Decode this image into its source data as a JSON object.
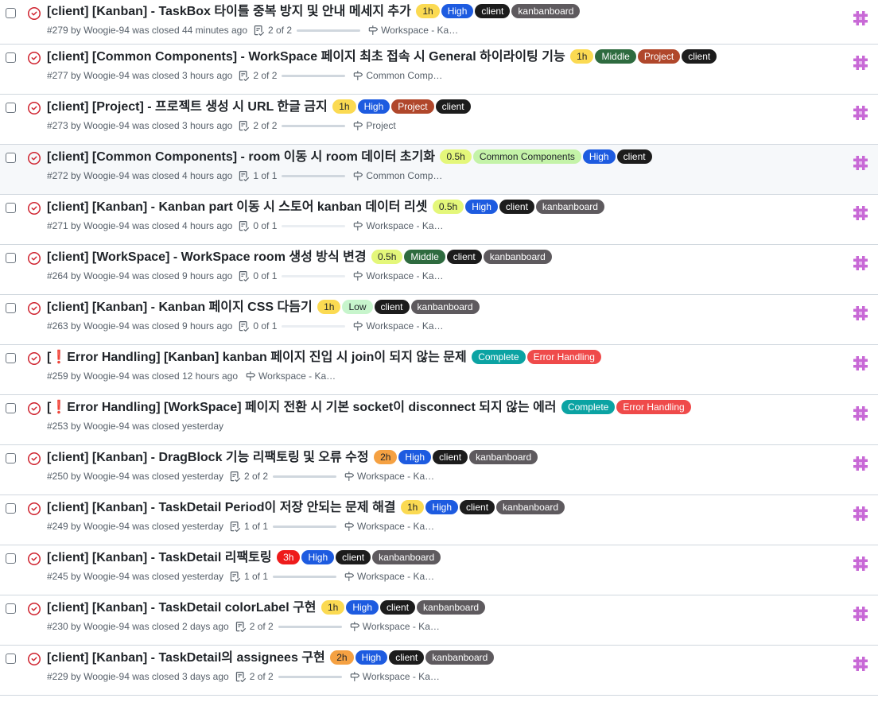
{
  "colors": {
    "closed_icon": "#cf222e",
    "accent": "#0969da",
    "avatar": "#c869d6"
  },
  "issues": [
    {
      "title": "[client] [Kanban] - TaskBox 타이틀 중복 방지 및 안내 메세지 추가",
      "number": "#279",
      "author": "Woogie-94",
      "closed": "44 minutes ago",
      "tasks": "2 of 2",
      "progress": 1.0,
      "milestone": "Workspace - Ka…",
      "labels": [
        {
          "text": "1h",
          "bg": "#fbda52",
          "fg": "#1f2328"
        },
        {
          "text": "High",
          "bg": "#1d5be0",
          "fg": "#ffffff"
        },
        {
          "text": "client",
          "bg": "#1c1c1c",
          "fg": "#ffffff"
        },
        {
          "text": "kanbanboard",
          "bg": "#5e5a5e",
          "fg": "#ffffff"
        }
      ]
    },
    {
      "title": "[client] [Common Components] - WorkSpace 페이지 최초 접속 시 General 하이라이팅 기능",
      "number": "#277",
      "author": "Woogie-94",
      "closed": "3 hours ago",
      "tasks": "2 of 2",
      "progress": 1.0,
      "milestone": "Common Comp…",
      "labels": [
        {
          "text": "1h",
          "bg": "#fbda52",
          "fg": "#1f2328"
        },
        {
          "text": "Middle",
          "bg": "#2e6b3f",
          "fg": "#ffffff"
        },
        {
          "text": "Project",
          "bg": "#b0472b",
          "fg": "#ffffff"
        },
        {
          "text": "client",
          "bg": "#1c1c1c",
          "fg": "#ffffff"
        }
      ]
    },
    {
      "title": "[client] [Project] - 프로젝트 생성 시 URL 한글 금지",
      "number": "#273",
      "author": "Woogie-94",
      "closed": "3 hours ago",
      "tasks": "2 of 2",
      "progress": 1.0,
      "milestone": "Project",
      "labels": [
        {
          "text": "1h",
          "bg": "#fbda52",
          "fg": "#1f2328"
        },
        {
          "text": "High",
          "bg": "#1d5be0",
          "fg": "#ffffff"
        },
        {
          "text": "Project",
          "bg": "#b0472b",
          "fg": "#ffffff"
        },
        {
          "text": "client",
          "bg": "#1c1c1c",
          "fg": "#ffffff"
        }
      ]
    },
    {
      "title": "[client] [Common Components] - room 이동 시 room 데이터 초기화",
      "number": "#272",
      "author": "Woogie-94",
      "closed": "4 hours ago",
      "tasks": "1 of 1",
      "progress": 1.0,
      "milestone": "Common Comp…",
      "labels": [
        {
          "text": "0.5h",
          "bg": "#e4f77a",
          "fg": "#1f2328"
        },
        {
          "text": "Common Components",
          "bg": "#c4f3a8",
          "fg": "#1f2328"
        },
        {
          "text": "High",
          "bg": "#1d5be0",
          "fg": "#ffffff"
        },
        {
          "text": "client",
          "bg": "#1c1c1c",
          "fg": "#ffffff"
        }
      ]
    },
    {
      "title": "[client] [Kanban] - Kanban part 이동 시 스토어 kanban 데이터 리셋",
      "number": "#271",
      "author": "Woogie-94",
      "closed": "4 hours ago",
      "tasks": "0 of 1",
      "progress": 0,
      "milestone": "Workspace - Ka…",
      "labels": [
        {
          "text": "0.5h",
          "bg": "#e4f77a",
          "fg": "#1f2328"
        },
        {
          "text": "High",
          "bg": "#1d5be0",
          "fg": "#ffffff"
        },
        {
          "text": "client",
          "bg": "#1c1c1c",
          "fg": "#ffffff"
        },
        {
          "text": "kanbanboard",
          "bg": "#5e5a5e",
          "fg": "#ffffff"
        }
      ]
    },
    {
      "title": "[client] [WorkSpace] - WorkSpace room 생성 방식 변경",
      "number": "#264",
      "author": "Woogie-94",
      "closed": "9 hours ago",
      "tasks": "0 of 1",
      "progress": 0,
      "milestone": "Workspace - Ka…",
      "labels": [
        {
          "text": "0.5h",
          "bg": "#e4f77a",
          "fg": "#1f2328"
        },
        {
          "text": "Middle",
          "bg": "#2e6b3f",
          "fg": "#ffffff"
        },
        {
          "text": "client",
          "bg": "#1c1c1c",
          "fg": "#ffffff"
        },
        {
          "text": "kanbanboard",
          "bg": "#5e5a5e",
          "fg": "#ffffff"
        }
      ]
    },
    {
      "title": "[client] [Kanban] - Kanban 페이지 CSS 다듬기",
      "number": "#263",
      "author": "Woogie-94",
      "closed": "9 hours ago",
      "tasks": "0 of 1",
      "progress": 0,
      "milestone": "Workspace - Ka…",
      "labels": [
        {
          "text": "1h",
          "bg": "#fbda52",
          "fg": "#1f2328"
        },
        {
          "text": "Low",
          "bg": "#c7f5cc",
          "fg": "#1f2328"
        },
        {
          "text": "client",
          "bg": "#1c1c1c",
          "fg": "#ffffff"
        },
        {
          "text": "kanbanboard",
          "bg": "#5e5a5e",
          "fg": "#ffffff"
        }
      ]
    },
    {
      "title_pre": "[",
      "warn": "❗",
      "title": "Error Handling] [Kanban] kanban 페이지 진입 시 join이 되지 않는 문제",
      "number": "#259",
      "author": "Woogie-94",
      "closed": "12 hours ago",
      "milestone": "Workspace - Ka…",
      "labels": [
        {
          "text": "Complete",
          "bg": "#0ba3a3",
          "fg": "#ffffff"
        },
        {
          "text": "Error Handling",
          "bg": "#ef4a4a",
          "fg": "#ffffff"
        }
      ]
    },
    {
      "title_pre": "[",
      "warn": "❗",
      "title": "Error Handling] [WorkSpace] 페이지 전환 시 기본 socket이 disconnect 되지 않는 에러",
      "number": "#253",
      "author": "Woogie-94",
      "closed": "yesterday",
      "labels": [
        {
          "text": "Complete",
          "bg": "#0ba3a3",
          "fg": "#ffffff"
        },
        {
          "text": "Error Handling",
          "bg": "#ef4a4a",
          "fg": "#ffffff"
        }
      ]
    },
    {
      "title": "[client] [Kanban] - DragBlock 기능 리팩토링 및 오류 수정",
      "number": "#250",
      "author": "Woogie-94",
      "closed": "yesterday",
      "tasks": "2 of 2",
      "progress": 1.0,
      "milestone": "Workspace - Ka…",
      "labels": [
        {
          "text": "2h",
          "bg": "#f5a142",
          "fg": "#1f2328"
        },
        {
          "text": "High",
          "bg": "#1d5be0",
          "fg": "#ffffff"
        },
        {
          "text": "client",
          "bg": "#1c1c1c",
          "fg": "#ffffff"
        },
        {
          "text": "kanbanboard",
          "bg": "#5e5a5e",
          "fg": "#ffffff"
        }
      ]
    },
    {
      "title": "[client] [Kanban] - TaskDetail Period이 저장 안되는 문제 해결",
      "number": "#249",
      "author": "Woogie-94",
      "closed": "yesterday",
      "tasks": "1 of 1",
      "progress": 1.0,
      "milestone": "Workspace - Ka…",
      "labels": [
        {
          "text": "1h",
          "bg": "#fbda52",
          "fg": "#1f2328"
        },
        {
          "text": "High",
          "bg": "#1d5be0",
          "fg": "#ffffff"
        },
        {
          "text": "client",
          "bg": "#1c1c1c",
          "fg": "#ffffff"
        },
        {
          "text": "kanbanboard",
          "bg": "#5e5a5e",
          "fg": "#ffffff"
        }
      ]
    },
    {
      "title": "[client] [Kanban] - TaskDetail 리팩토링",
      "number": "#245",
      "author": "Woogie-94",
      "closed": "yesterday",
      "tasks": "1 of 1",
      "progress": 1.0,
      "milestone": "Workspace - Ka…",
      "labels": [
        {
          "text": "3h",
          "bg": "#ee1b1b",
          "fg": "#ffffff"
        },
        {
          "text": "High",
          "bg": "#1d5be0",
          "fg": "#ffffff"
        },
        {
          "text": "client",
          "bg": "#1c1c1c",
          "fg": "#ffffff"
        },
        {
          "text": "kanbanboard",
          "bg": "#5e5a5e",
          "fg": "#ffffff"
        }
      ]
    },
    {
      "title": "[client] [Kanban] - TaskDetail colorLabel 구현",
      "number": "#230",
      "author": "Woogie-94",
      "closed": "2 days ago",
      "tasks": "2 of 2",
      "progress": 1.0,
      "milestone": "Workspace - Ka…",
      "labels": [
        {
          "text": "1h",
          "bg": "#fbda52",
          "fg": "#1f2328"
        },
        {
          "text": "High",
          "bg": "#1d5be0",
          "fg": "#ffffff"
        },
        {
          "text": "client",
          "bg": "#1c1c1c",
          "fg": "#ffffff"
        },
        {
          "text": "kanbanboard",
          "bg": "#5e5a5e",
          "fg": "#ffffff"
        }
      ]
    },
    {
      "title": "[client] [Kanban] - TaskDetail의 assignees 구현",
      "number": "#229",
      "author": "Woogie-94",
      "closed": "3 days ago",
      "tasks": "2 of 2",
      "progress": 1.0,
      "milestone": "Workspace - Ka…",
      "labels": [
        {
          "text": "2h",
          "bg": "#f5a142",
          "fg": "#1f2328"
        },
        {
          "text": "High",
          "bg": "#1d5be0",
          "fg": "#ffffff"
        },
        {
          "text": "client",
          "bg": "#1c1c1c",
          "fg": "#ffffff"
        },
        {
          "text": "kanbanboard",
          "bg": "#5e5a5e",
          "fg": "#ffffff"
        }
      ]
    }
  ],
  "ui": {
    "by_text": "by",
    "closed_text": "was closed"
  }
}
